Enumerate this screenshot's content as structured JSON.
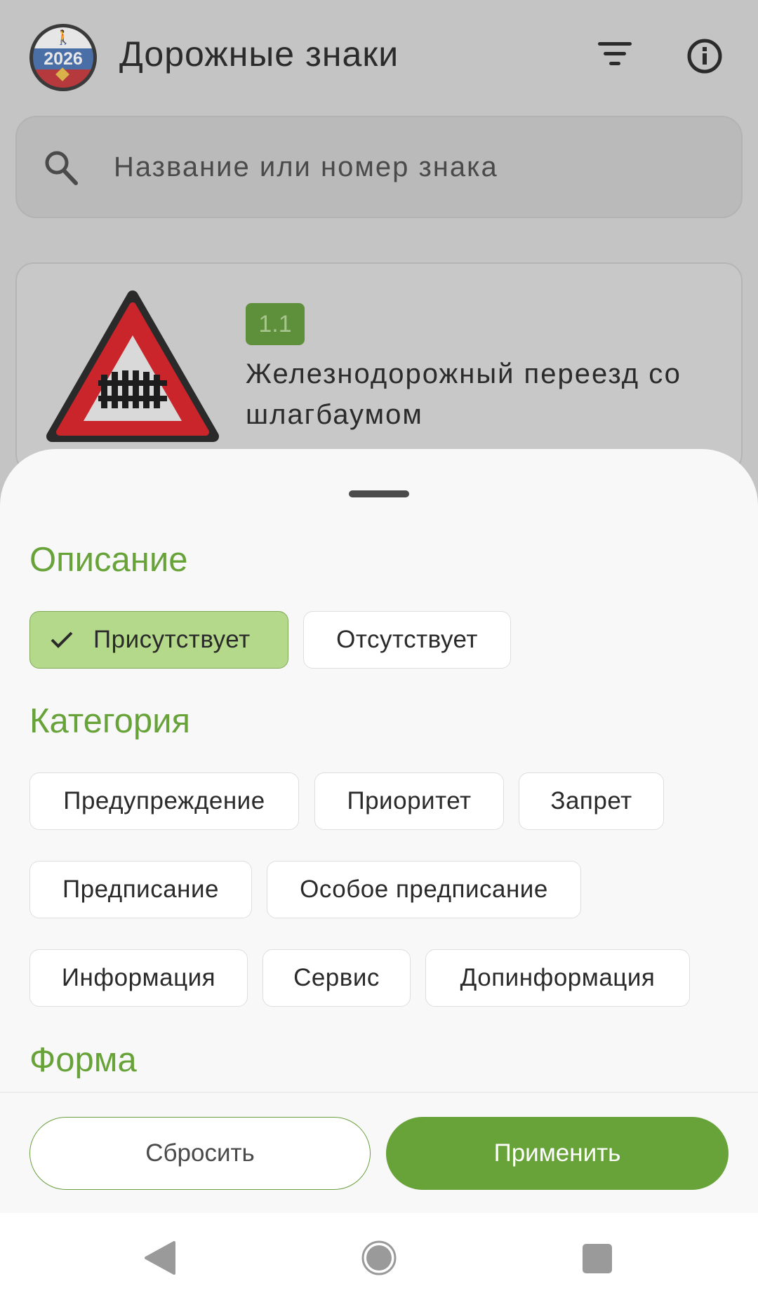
{
  "app": {
    "title": "Дорожные знаки",
    "logo_year": "2026"
  },
  "search": {
    "placeholder": "Название или номер знака"
  },
  "sign_card": {
    "number": "1.1",
    "name": "Железнодорожный переезд со шлагбаумом"
  },
  "filter_sheet": {
    "description_title": "Описание",
    "description_options": [
      {
        "label": "Присутствует",
        "selected": true
      },
      {
        "label": "Отсутствует",
        "selected": false
      }
    ],
    "category_title": "Категория",
    "category_options": [
      {
        "label": "Предупреждение"
      },
      {
        "label": "Приоритет"
      },
      {
        "label": "Запрет"
      },
      {
        "label": "Предписание"
      },
      {
        "label": "Особое предписание"
      },
      {
        "label": "Информация"
      },
      {
        "label": "Сервис"
      },
      {
        "label": "Допинформация"
      }
    ],
    "shape_title": "Форма",
    "reset_label": "Сбросить",
    "apply_label": "Применить"
  },
  "colors": {
    "accent": "#68a33a",
    "chip_selected": "#b4d98a",
    "sign_red": "#d42b30"
  },
  "icons": {
    "filter": "filter-icon",
    "info": "info-icon",
    "search": "search-icon",
    "check": "check-icon",
    "nav_back": "nav-back-icon",
    "nav_home": "nav-home-icon",
    "nav_recent": "nav-recent-icon"
  }
}
